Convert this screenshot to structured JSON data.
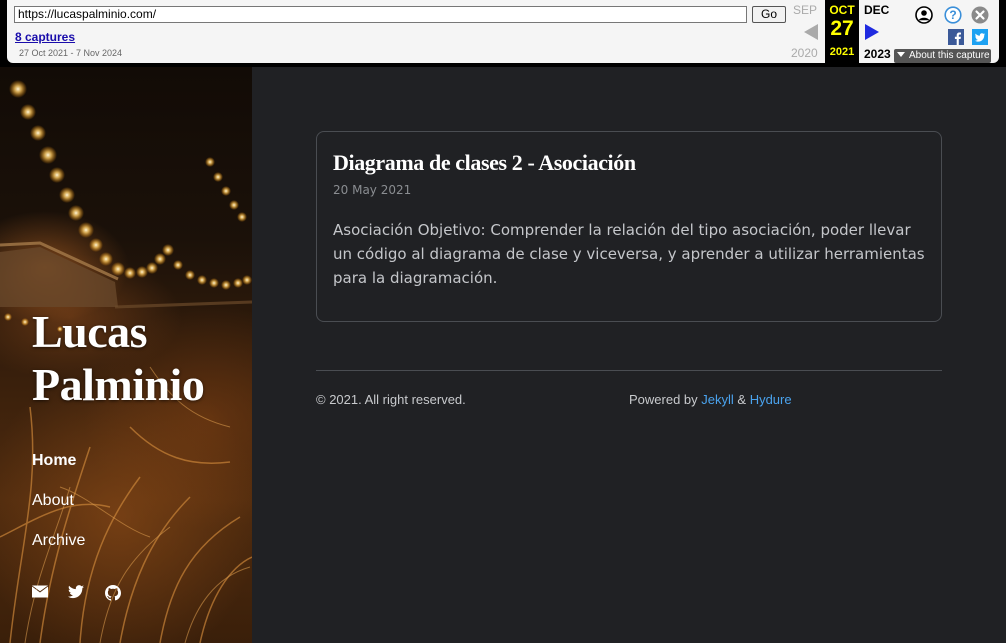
{
  "wayback": {
    "url": "https://lucaspalminio.com/",
    "go_label": "Go",
    "captures_link": "8 captures",
    "date_range": "27 Oct 2021 - 7 Nov 2024",
    "prev": {
      "month": "SEP",
      "year": "2020"
    },
    "current": {
      "month": "OCT",
      "day": "27",
      "year": "2021"
    },
    "next": {
      "month": "DEC",
      "year": "2023"
    },
    "about_label": "About this capture",
    "icons": [
      "user-icon",
      "help-icon",
      "close-icon",
      "facebook-icon",
      "twitter-icon"
    ]
  },
  "sidebar": {
    "site_title_line1": "Lucas",
    "site_title_line2": "Palminio",
    "nav": [
      {
        "label": "Home",
        "active": true
      },
      {
        "label": "About",
        "active": false
      },
      {
        "label": "Archive",
        "active": false
      }
    ],
    "social_icons": [
      "envelope-icon",
      "twitter-icon",
      "github-icon"
    ]
  },
  "post": {
    "title": "Diagrama de clases 2 - Asociación",
    "date": "20 May 2021",
    "excerpt": "Asociación Objetivo: Comprender la relación del tipo asociación, poder llevar un código al diagrama de clase y viceversa, y aprender a utilizar herramientas para la diagramación."
  },
  "footer": {
    "copyright": "© 2021. All right reserved.",
    "powered_prefix": "Powered by ",
    "jekyll": "Jekyll",
    "amp": " & ",
    "hydure": "Hydure"
  },
  "colors": {
    "page_background": "#202124",
    "link": "#4aa3ee",
    "wayback_current": "#ffff00",
    "wayback_next_arrow": "#1f2ae0"
  }
}
